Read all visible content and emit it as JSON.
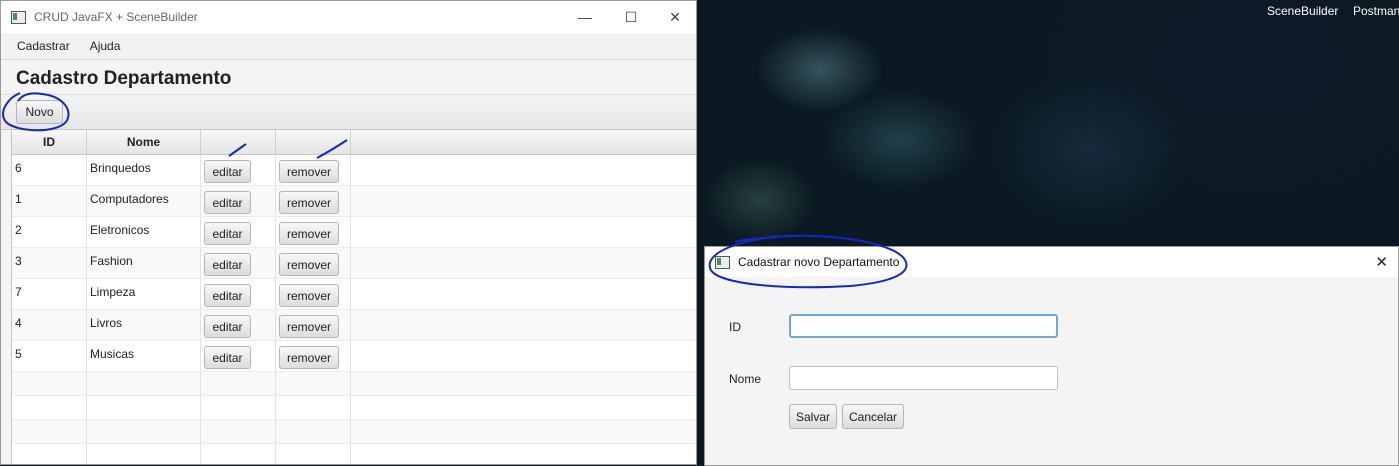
{
  "desktop": {
    "labels": [
      "SceneBuilder",
      "Postman"
    ]
  },
  "main_window": {
    "title": "CRUD JavaFX + SceneBuilder",
    "controls": {
      "minimize": "—",
      "maximize": "☐",
      "close": "✕"
    },
    "menu": [
      "Cadastrar",
      "Ajuda"
    ],
    "page_title": "Cadastro Departamento",
    "novo_label": "Novo",
    "table": {
      "columns": [
        "ID",
        "Nome",
        "",
        ""
      ],
      "edit_label": "editar",
      "remove_label": "remover",
      "rows": [
        {
          "id": "6",
          "nome": "Brinquedos"
        },
        {
          "id": "1",
          "nome": "Computadores"
        },
        {
          "id": "2",
          "nome": "Eletronicos"
        },
        {
          "id": "3",
          "nome": "Fashion"
        },
        {
          "id": "7",
          "nome": "Limpeza"
        },
        {
          "id": "4",
          "nome": "Livros"
        },
        {
          "id": "5",
          "nome": "Musicas"
        }
      ]
    }
  },
  "dialog": {
    "title": "Cadastrar novo Departamento",
    "close": "✕",
    "id_label": "ID",
    "id_value": "",
    "nome_label": "Nome",
    "nome_value": "",
    "save_label": "Salvar",
    "cancel_label": "Cancelar"
  },
  "colors": {
    "annotation": "#1028c8",
    "focus_border": "#6aa9d8"
  }
}
